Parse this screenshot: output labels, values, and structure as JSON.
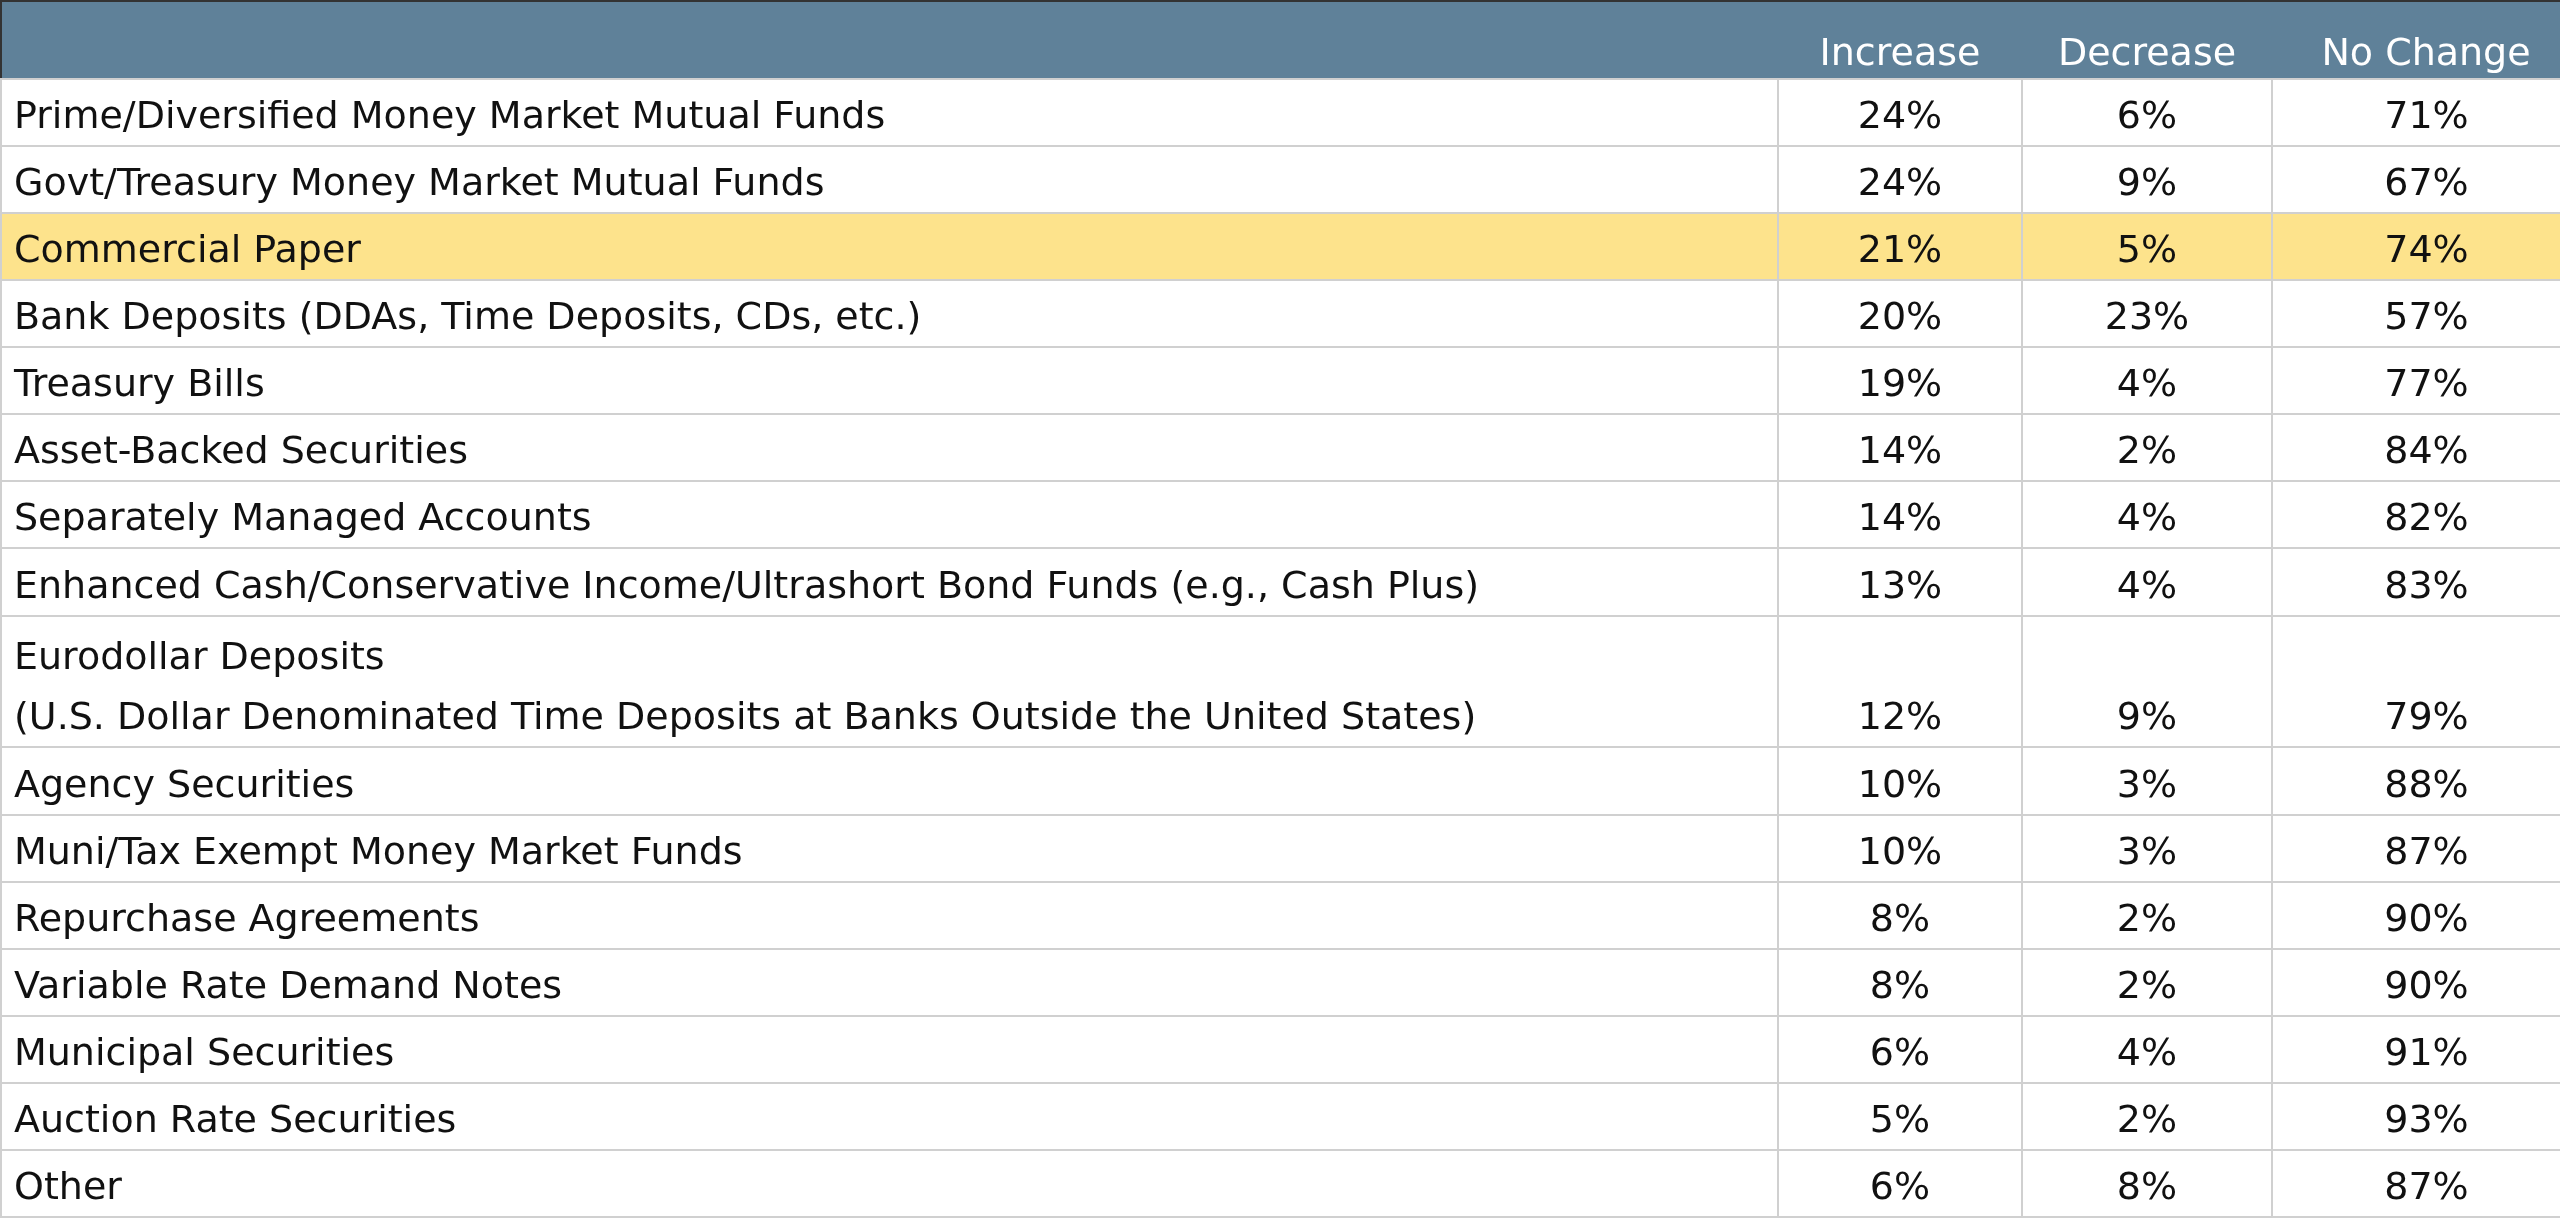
{
  "table": {
    "columns": [
      {
        "label": "Increase"
      },
      {
        "label": "Decrease"
      },
      {
        "label": "No Change"
      }
    ],
    "rows": [
      {
        "label": "Prime/Diversified Money Market Mutual Funds",
        "highlighted": false,
        "values": [
          "24%",
          "6%",
          "71%"
        ]
      },
      {
        "label": "Govt/Treasury Money Market Mutual Funds",
        "highlighted": false,
        "values": [
          "24%",
          "9%",
          "67%"
        ]
      },
      {
        "label": "Commercial Paper",
        "highlighted": true,
        "values": [
          "21%",
          "5%",
          "74%"
        ]
      },
      {
        "label": "Bank Deposits (DDAs, Time Deposits, CDs, etc.)",
        "highlighted": false,
        "values": [
          "20%",
          "23%",
          "57%"
        ]
      },
      {
        "label": "Treasury Bills",
        "highlighted": false,
        "values": [
          "19%",
          "4%",
          "77%"
        ]
      },
      {
        "label": "Asset-Backed Securities",
        "highlighted": false,
        "values": [
          "14%",
          "2%",
          "84%"
        ]
      },
      {
        "label": "Separately Managed Accounts",
        "highlighted": false,
        "values": [
          "14%",
          "4%",
          "82%"
        ]
      },
      {
        "label": "Enhanced Cash/Conservative Income/Ultrashort Bond Funds (e.g., Cash Plus)",
        "highlighted": false,
        "values": [
          "13%",
          "4%",
          "83%"
        ]
      },
      {
        "label": "Eurodollar Deposits",
        "sublabel": "(U.S. Dollar Denominated Time Deposits at Banks Outside the United States)",
        "highlighted": false,
        "values": [
          "12%",
          "9%",
          "79%"
        ]
      },
      {
        "label": "Agency Securities",
        "highlighted": false,
        "values": [
          "10%",
          "3%",
          "88%"
        ]
      },
      {
        "label": "Muni/Tax Exempt Money Market Funds",
        "highlighted": false,
        "values": [
          "10%",
          "3%",
          "87%"
        ]
      },
      {
        "label": "Repurchase Agreements",
        "highlighted": false,
        "values": [
          "8%",
          "2%",
          "90%"
        ]
      },
      {
        "label": "Variable Rate Demand Notes",
        "highlighted": false,
        "values": [
          "8%",
          "2%",
          "90%"
        ]
      },
      {
        "label": "Municipal Securities",
        "highlighted": false,
        "values": [
          "6%",
          "4%",
          "91%"
        ]
      },
      {
        "label": "Auction Rate Securities",
        "highlighted": false,
        "values": [
          "5%",
          "2%",
          "93%"
        ]
      },
      {
        "label": "Other",
        "highlighted": false,
        "values": [
          "6%",
          "8%",
          "87%"
        ]
      }
    ]
  }
}
